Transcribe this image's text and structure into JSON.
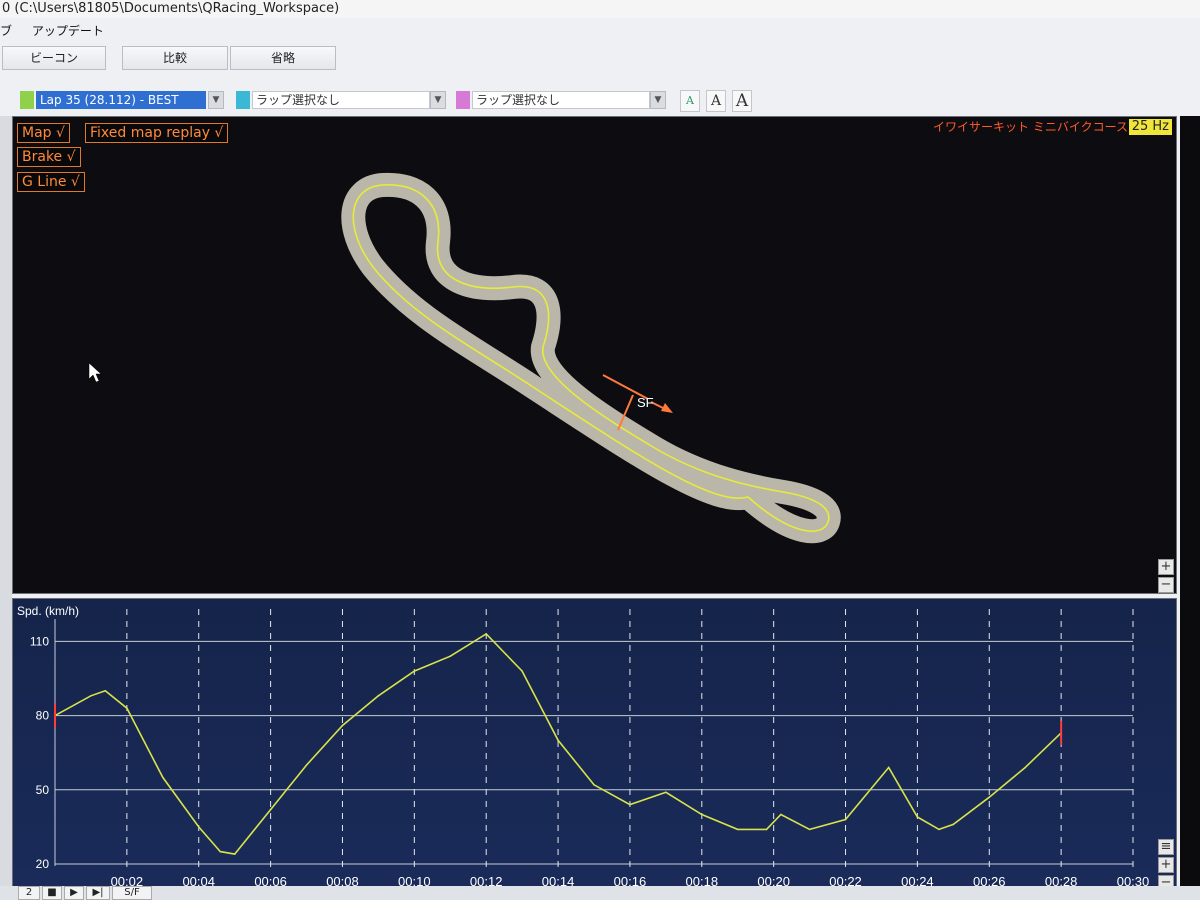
{
  "window": {
    "title": "0 (C:\\Users\\81805\\Documents\\QRacing_Workspace)"
  },
  "menu": [
    "ブ",
    "アップデート"
  ],
  "toolbar": {
    "beacon": "ビーコン",
    "compare": "比較",
    "omit": "省略"
  },
  "laps": [
    {
      "label": "Lap 35  (28.112) - BEST",
      "color": "#8fd14a"
    },
    {
      "label": "ラップ選択なし",
      "color": "#3bb8d4"
    },
    {
      "label": "ラップ選択なし",
      "color": "#d67ad6"
    }
  ],
  "font_buttons": [
    "A",
    "A",
    "A"
  ],
  "map": {
    "toggles": {
      "map": "Map  √",
      "fixed": "Fixed map replay  √",
      "brake": "Brake  √",
      "gline": "G Line  √"
    },
    "course_name": "イワイサーキット ミニバイクコース",
    "rate": "25 Hz",
    "start_finish": "SF"
  },
  "zoom": {
    "plus": "+",
    "minus": "−"
  },
  "chart_data": {
    "type": "line",
    "ylabel": "Spd. (km/h)",
    "yticks": [
      20,
      50,
      80,
      110
    ],
    "ylim": [
      20,
      115
    ],
    "xlim": [
      0,
      30
    ],
    "xticks": [
      "00:02",
      "00:04",
      "00:06",
      "00:08",
      "00:10",
      "00:12",
      "00:14",
      "00:16",
      "00:18",
      "00:20",
      "00:22",
      "00:24",
      "00:26",
      "00:28",
      "00:30"
    ],
    "grid": true,
    "series": [
      {
        "color": "#d8e34a",
        "x": [
          0,
          1,
          1.4,
          2.0,
          3.0,
          4.0,
          4.6,
          5.0,
          6.0,
          7.0,
          8.0,
          9.0,
          10.0,
          11.0,
          12.0,
          13.0,
          14.0,
          15.0,
          16.0,
          17.0,
          18.0,
          19.0,
          19.8,
          20.2,
          21.0,
          22.0,
          23.2,
          24.0,
          24.6,
          25.0,
          26.0,
          27.0,
          28.0
        ],
        "y": [
          80,
          88,
          90,
          83,
          55,
          35,
          25,
          24,
          42,
          60,
          76,
          88,
          98,
          104,
          113,
          98,
          70,
          52,
          44,
          49,
          40,
          34,
          34,
          40,
          34,
          38,
          59,
          39,
          34,
          36,
          47,
          59,
          73
        ]
      }
    ],
    "markers": [
      0,
      28
    ]
  },
  "bottom": {
    "items": [
      "2",
      "■",
      "▶",
      "▶|",
      "S/F"
    ]
  }
}
